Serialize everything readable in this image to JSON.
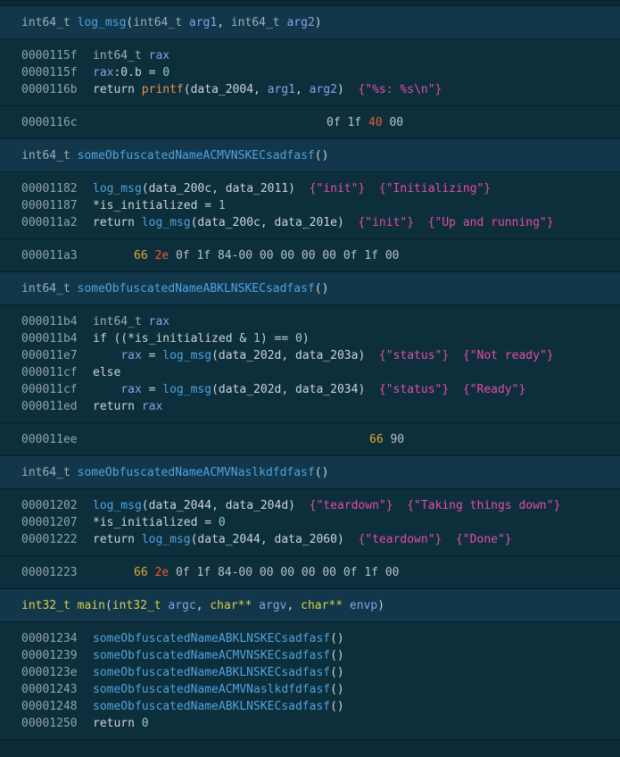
{
  "functions": [
    {
      "header": {
        "ret": "int64_t",
        "name": "log_msg",
        "params": [
          [
            "int64_t",
            "arg1"
          ],
          [
            "int64_t",
            "arg2"
          ]
        ]
      },
      "lines": [
        {
          "addr": "0000115f",
          "tokens": [
            [
              "ty",
              "int64_t"
            ],
            [
              "kw",
              " "
            ],
            [
              "var",
              "rax"
            ]
          ]
        },
        {
          "addr": "0000115f",
          "tokens": [
            [
              "var",
              "rax"
            ],
            [
              "kw",
              ":0.b = "
            ],
            [
              "num",
              "0"
            ]
          ]
        },
        {
          "addr": "0000116b",
          "tokens": [
            [
              "kw",
              "return "
            ],
            [
              "imp",
              "printf"
            ],
            [
              "kw",
              "(data_2004, "
            ],
            [
              "var",
              "arg1"
            ],
            [
              "kw",
              ", "
            ],
            [
              "var",
              "arg2"
            ],
            [
              "kw",
              ")  "
            ],
            [
              "str",
              "{\"%s: %s\\n\"}"
            ]
          ]
        }
      ],
      "bytes": {
        "addr": "0000116c",
        "values": [
          [
            "n",
            "0f"
          ],
          [
            "n",
            "1f"
          ],
          [
            "r",
            "40"
          ],
          [
            "n",
            "00"
          ]
        ],
        "offset": 366
      }
    },
    {
      "header": {
        "ret": "int64_t",
        "name": "someObfuscatedNameACMVNSKECsadfasf",
        "params": []
      },
      "lines": [
        {
          "addr": "00001182",
          "tokens": [
            [
              "fn",
              "log_msg"
            ],
            [
              "kw",
              "(data_200c, data_2011)  "
            ],
            [
              "str",
              "{\"init\"}  {\"Initializing\"}"
            ]
          ]
        },
        {
          "addr": "00001187",
          "tokens": [
            [
              "kw",
              "*is_initialized = "
            ],
            [
              "num",
              "1"
            ]
          ]
        },
        {
          "addr": "000011a2",
          "tokens": [
            [
              "kw",
              "return "
            ],
            [
              "fn",
              "log_msg"
            ],
            [
              "kw",
              "(data_200c, data_201e)  "
            ],
            [
              "str",
              "{\"init\"}  {\"Up and running\"}"
            ]
          ]
        }
      ],
      "bytes": {
        "addr": "000011a3",
        "values": [
          [
            "h",
            "66"
          ],
          [
            "r",
            "2e"
          ],
          [
            "n",
            "0f"
          ],
          [
            "n",
            "1f"
          ],
          [
            "n",
            "84-00"
          ],
          [
            "n",
            "00"
          ],
          [
            "n",
            "00"
          ],
          [
            "n",
            "00"
          ],
          [
            "n",
            "00"
          ],
          [
            "n",
            "0f"
          ],
          [
            "n",
            "1f"
          ],
          [
            "n",
            "00"
          ]
        ],
        "offset": 150
      }
    },
    {
      "header": {
        "ret": "int64_t",
        "name": "someObfuscatedNameABKLNSKECsadfasf",
        "params": []
      },
      "lines": [
        {
          "addr": "000011b4",
          "tokens": [
            [
              "ty",
              "int64_t"
            ],
            [
              "kw",
              " "
            ],
            [
              "var",
              "rax"
            ]
          ]
        },
        {
          "addr": "000011b4",
          "tokens": [
            [
              "kw",
              "if ((*is_initialized & "
            ],
            [
              "num",
              "1"
            ],
            [
              "kw",
              ") == "
            ],
            [
              "num",
              "0"
            ],
            [
              "kw",
              ")"
            ]
          ]
        },
        {
          "addr": "000011e7",
          "tokens": [
            [
              "kw",
              "    "
            ],
            [
              "var",
              "rax"
            ],
            [
              "kw",
              " = "
            ],
            [
              "fn",
              "log_msg"
            ],
            [
              "kw",
              "(data_202d, data_203a)  "
            ],
            [
              "str",
              "{\"status\"}  {\"Not ready\"}"
            ]
          ]
        },
        {
          "addr": "000011cf",
          "tokens": [
            [
              "kw",
              "else"
            ]
          ]
        },
        {
          "addr": "000011cf",
          "tokens": [
            [
              "kw",
              "    "
            ],
            [
              "var",
              "rax"
            ],
            [
              "kw",
              " = "
            ],
            [
              "fn",
              "log_msg"
            ],
            [
              "kw",
              "(data_202d, data_2034)  "
            ],
            [
              "str",
              "{\"status\"}  {\"Ready\"}"
            ]
          ]
        },
        {
          "addr": "000011ed",
          "tokens": [
            [
              "kw",
              "return "
            ],
            [
              "var",
              "rax"
            ]
          ]
        }
      ],
      "bytes": {
        "addr": "000011ee",
        "values": [
          [
            "h",
            "66"
          ],
          [
            "n",
            "90"
          ]
        ],
        "offset": 414
      }
    },
    {
      "header": {
        "ret": "int64_t",
        "name": "someObfuscatedNameACMVNaslkdfdfasf",
        "params": []
      },
      "lines": [
        {
          "addr": "00001202",
          "tokens": [
            [
              "fn",
              "log_msg"
            ],
            [
              "kw",
              "(data_2044, data_204d)  "
            ],
            [
              "str",
              "{\"teardown\"}  {\"Taking things down\"}"
            ]
          ]
        },
        {
          "addr": "00001207",
          "tokens": [
            [
              "kw",
              "*is_initialized = "
            ],
            [
              "num",
              "0"
            ]
          ]
        },
        {
          "addr": "00001222",
          "tokens": [
            [
              "kw",
              "return "
            ],
            [
              "fn",
              "log_msg"
            ],
            [
              "kw",
              "(data_2044, data_2060)  "
            ],
            [
              "str",
              "{\"teardown\"}  {\"Done\"}"
            ]
          ]
        }
      ],
      "bytes": {
        "addr": "00001223",
        "values": [
          [
            "h",
            "66"
          ],
          [
            "r",
            "2e"
          ],
          [
            "n",
            "0f"
          ],
          [
            "n",
            "1f"
          ],
          [
            "n",
            "84-00"
          ],
          [
            "n",
            "00"
          ],
          [
            "n",
            "00"
          ],
          [
            "n",
            "00"
          ],
          [
            "n",
            "00"
          ],
          [
            "n",
            "0f"
          ],
          [
            "n",
            "1f"
          ],
          [
            "n",
            "00"
          ]
        ],
        "offset": 150
      }
    },
    {
      "header": {
        "ret": "int32_t",
        "name": "main",
        "params": [
          [
            "int32_t",
            "argc"
          ],
          [
            "char**",
            "argv"
          ],
          [
            "char**",
            "envp"
          ]
        ],
        "yellow": true
      },
      "lines": [
        {
          "addr": "00001234",
          "tokens": [
            [
              "fn",
              "someObfuscatedNameABKLNSKECsadfasf"
            ],
            [
              "kw",
              "()"
            ]
          ]
        },
        {
          "addr": "00001239",
          "tokens": [
            [
              "fn",
              "someObfuscatedNameACMVNSKECsadfasf"
            ],
            [
              "kw",
              "()"
            ]
          ]
        },
        {
          "addr": "0000123e",
          "tokens": [
            [
              "fn",
              "someObfuscatedNameABKLNSKECsadfasf"
            ],
            [
              "kw",
              "()"
            ]
          ]
        },
        {
          "addr": "00001243",
          "tokens": [
            [
              "fn",
              "someObfuscatedNameACMVNaslkdfdfasf"
            ],
            [
              "kw",
              "()"
            ]
          ]
        },
        {
          "addr": "00001248",
          "tokens": [
            [
              "fn",
              "someObfuscatedNameABKLNSKECsadfasf"
            ],
            [
              "kw",
              "()"
            ]
          ]
        },
        {
          "addr": "00001250",
          "tokens": [
            [
              "kw",
              "return "
            ],
            [
              "num",
              "0"
            ]
          ]
        }
      ]
    }
  ]
}
